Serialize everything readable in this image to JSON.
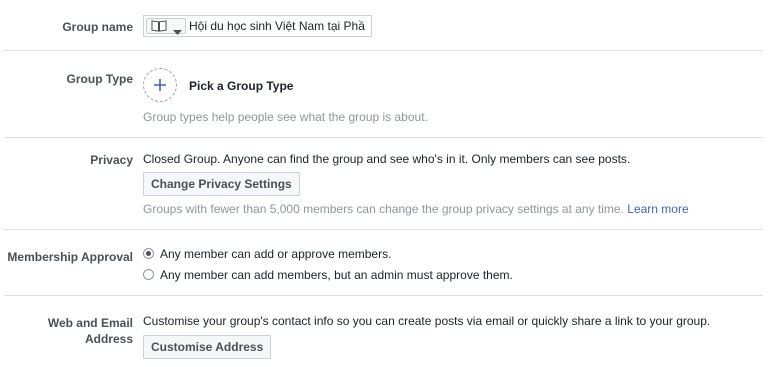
{
  "group_name": {
    "label": "Group name",
    "value": "Hội du học sinh Việt Nam tại Phầ",
    "icon": "book-icon",
    "dropdown_icon": "chevron-down-icon"
  },
  "group_type": {
    "label": "Group Type",
    "action": "Pick a Group Type",
    "help": "Group types help people see what the group is about.",
    "icon": "plus-icon"
  },
  "privacy": {
    "label": "Privacy",
    "description": "Closed Group. Anyone can find the group and see who's in it. Only members can see posts.",
    "button": "Change Privacy Settings",
    "help": "Groups with fewer than 5,000 members can change the group privacy settings at any time.",
    "help_link": "Learn more"
  },
  "membership": {
    "label": "Membership Approval",
    "options": [
      {
        "label": "Any member can add or approve members.",
        "selected": true
      },
      {
        "label": "Any member can add members, but an admin must approve them.",
        "selected": false
      }
    ]
  },
  "web_email": {
    "label_line1": "Web and Email",
    "label_line2": "Address",
    "description": "Customise your group's contact info so you can create posts via email or quickly share a link to your group.",
    "button": "Customise Address"
  },
  "colors": {
    "link": "#4267b2",
    "help_text": "#90949c",
    "divider": "#dddfe2"
  }
}
